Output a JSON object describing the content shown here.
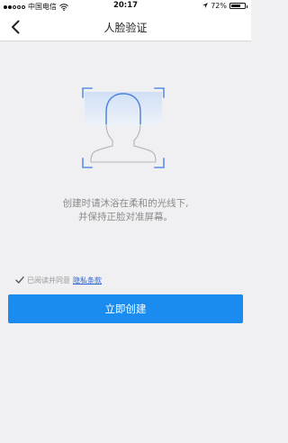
{
  "status_bar": {
    "carrier": "中国电信",
    "time": "20:17",
    "battery_percent": "72%",
    "battery_level": 0.72
  },
  "header": {
    "title": "人脸验证"
  },
  "instructions": {
    "line1": "创建时请沐浴在柔和的光线下,",
    "line2": "并保持正脸对准屏幕。"
  },
  "consent": {
    "checked": true,
    "text": "已阅读并同意",
    "link_label": "隐私条款"
  },
  "actions": {
    "create_label": "立即创建"
  },
  "colors": {
    "accent": "#1a8cf0",
    "link": "#2a64d8",
    "frame_corner": "#5b8ee8",
    "face_fill": "#dbe7fb",
    "background": "#f0f0f2"
  }
}
